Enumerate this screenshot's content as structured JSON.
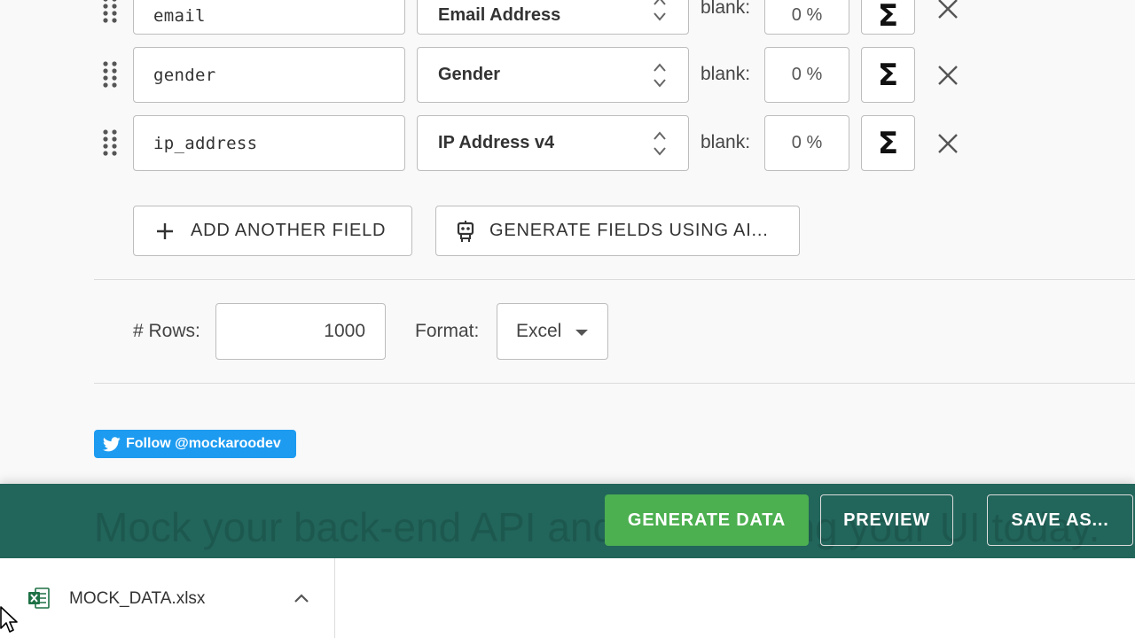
{
  "fields": [
    {
      "name": "email",
      "type": "Email Address",
      "blank_label": "blank:",
      "blank_pct": "0 %",
      "sigma": "Σ"
    },
    {
      "name": "gender",
      "type": "Gender",
      "blank_label": "blank:",
      "blank_pct": "0 %",
      "sigma": "Σ"
    },
    {
      "name": "ip_address",
      "type": "IP Address v4",
      "blank_label": "blank:",
      "blank_pct": "0 %",
      "sigma": "Σ"
    }
  ],
  "actions": {
    "add_field": "ADD ANOTHER FIELD",
    "generate_ai": "GENERATE FIELDS USING AI..."
  },
  "options": {
    "rows_label": "# Rows:",
    "rows_value": "1000",
    "format_label": "Format:",
    "format_value": "Excel"
  },
  "twitter": {
    "label": "Follow @mockaroodev"
  },
  "footer": {
    "tagline": "Mock your back-end API and start coding your UI today.",
    "generate": "GENERATE DATA",
    "preview": "PREVIEW",
    "save_as": "SAVE AS..."
  },
  "download": {
    "filename": "MOCK_DATA.xlsx"
  },
  "icons": {
    "drag": "drag-handle-icon",
    "updown": "updown-arrows-icon",
    "remove": "close-icon",
    "plus": "plus-icon",
    "robot": "robot-icon",
    "twitter": "twitter-bird-icon",
    "excel": "excel-file-icon",
    "chevron": "chevron-up-icon",
    "cursor": "mouse-cursor-icon"
  },
  "colors": {
    "footer_bg": "#22655a",
    "generate_bg": "#4caf50",
    "twitter_bg": "#1d9bf0",
    "excel_green": "#1e7145"
  }
}
